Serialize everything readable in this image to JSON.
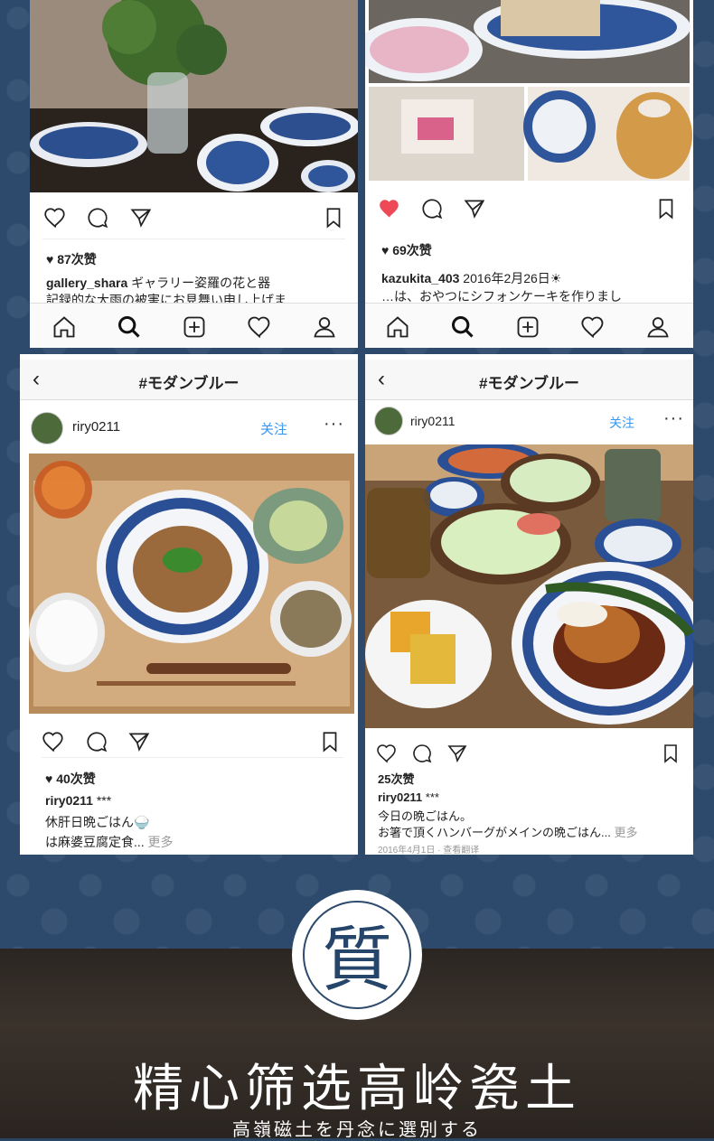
{
  "posts": {
    "p1": {
      "likes": "87次赞",
      "user": "gallery_shara",
      "caption1": " ギャラリー姿羅の花と器",
      "caption2": "記録的な大雨の被害にお見舞い申し上げま"
    },
    "p2": {
      "likes": "69次赞",
      "user": "kazukita_403",
      "caption1": " 2016年2月26日☀",
      "caption2": "…は、おやつにシフォンケーキを作りまし"
    },
    "p3": {
      "nav_title": "#モダンブルー",
      "user": "riry0211",
      "follow": "关注",
      "likes": "40次赞",
      "cap_user": "riry0211",
      "cap_tail": " ***",
      "caption1": "休肝日晩ごはん🍚",
      "caption2": "は麻婆豆腐定食...",
      "more": " 更多"
    },
    "p4": {
      "nav_title": "#モダンブルー",
      "user": "riry0211",
      "follow": "关注",
      "likes": "25次赞",
      "cap_user": "riry0211",
      "cap_tail": " ***",
      "caption1": "今日の晩ごはん。",
      "caption2": "お箸で頂くハンバーグがメインの晩ごはん...",
      "more": " 更多",
      "meta": "2016年4月1日 · 查看翻译"
    }
  },
  "footer": {
    "seal_char": "質",
    "headline": "精心筛选高岭瓷土",
    "subline": "高嶺磁土を丹念に選別する"
  },
  "colors": {
    "accent_blue": "#2d4a6c",
    "like_red": "#ed4956",
    "follow_blue": "#3897f0"
  }
}
